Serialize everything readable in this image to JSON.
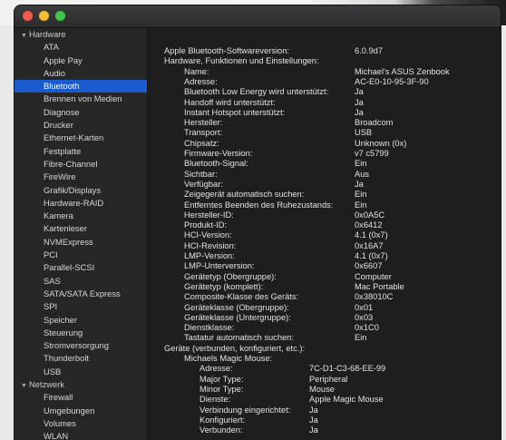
{
  "sidebar": {
    "items": [
      {
        "label": "Hardware",
        "group": true
      },
      {
        "label": "ATA"
      },
      {
        "label": "Apple Pay"
      },
      {
        "label": "Audio"
      },
      {
        "label": "Bluetooth",
        "selected": true
      },
      {
        "label": "Brennen von Medien"
      },
      {
        "label": "Diagnose"
      },
      {
        "label": "Drucker"
      },
      {
        "label": "Ethernet-Karten"
      },
      {
        "label": "Festplatte"
      },
      {
        "label": "Fibre-Channel"
      },
      {
        "label": "FireWire"
      },
      {
        "label": "Grafik/Displays"
      },
      {
        "label": "Hardware-RAID"
      },
      {
        "label": "Kamera"
      },
      {
        "label": "Kartenleser"
      },
      {
        "label": "NVMExpress"
      },
      {
        "label": "PCI"
      },
      {
        "label": "Parallel-SCSI"
      },
      {
        "label": "SAS"
      },
      {
        "label": "SATA/SATA Express"
      },
      {
        "label": "SPI"
      },
      {
        "label": "Speicher"
      },
      {
        "label": "Steuerung"
      },
      {
        "label": "Stromversorgung"
      },
      {
        "label": "Thunderbolt"
      },
      {
        "label": "USB"
      },
      {
        "label": "Netzwerk",
        "group": true
      },
      {
        "label": "Firewall"
      },
      {
        "label": "Umgebungen"
      },
      {
        "label": "Volumes"
      },
      {
        "label": "WLAN"
      }
    ]
  },
  "details": {
    "rows": [
      {
        "label": "Apple Bluetooth-Softwareversion:",
        "value": "6.0.9d7",
        "indent": 0
      },
      {
        "label": "Hardware, Funktionen und Einstellungen:",
        "value": "",
        "indent": 0
      },
      {
        "label": "Name:",
        "value": "Michael's ASUS Zenbook",
        "indent": 1
      },
      {
        "label": "Adresse:",
        "value": "AC-E0-10-95-3F-90",
        "indent": 1
      },
      {
        "label": "Bluetooth Low Energy wird unterstützt:",
        "value": "Ja",
        "indent": 1
      },
      {
        "label": "Handoff wird unterstützt:",
        "value": "Ja",
        "indent": 1
      },
      {
        "label": "Instant Hotspot unterstützt:",
        "value": "Ja",
        "indent": 1
      },
      {
        "label": "Hersteller:",
        "value": "Broadcom",
        "indent": 1
      },
      {
        "label": "Transport:",
        "value": "USB",
        "indent": 1
      },
      {
        "label": "Chipsatz:",
        "value": "Unknown (0x)",
        "indent": 1
      },
      {
        "label": "Firmware-Version:",
        "value": "v7 c5799",
        "indent": 1
      },
      {
        "label": "Bluetooth-Signal:",
        "value": "Ein",
        "indent": 1
      },
      {
        "label": "Sichtbar:",
        "value": "Aus",
        "indent": 1
      },
      {
        "label": "Verfügbar:",
        "value": "Ja",
        "indent": 1
      },
      {
        "label": "Zeigegerät automatisch suchen:",
        "value": "Ein",
        "indent": 1
      },
      {
        "label": "Entferntes Beenden des Ruhezustands:",
        "value": "Ein",
        "indent": 1
      },
      {
        "label": "Hersteller-ID:",
        "value": "0x0A5C",
        "indent": 1
      },
      {
        "label": "Produkt-ID:",
        "value": "0x6412",
        "indent": 1
      },
      {
        "label": "HCI-Version:",
        "value": "4.1 (0x7)",
        "indent": 1
      },
      {
        "label": "HCI-Revision:",
        "value": "0x16A7",
        "indent": 1
      },
      {
        "label": "LMP-Version:",
        "value": "4.1 (0x7)",
        "indent": 1
      },
      {
        "label": "LMP-Unterversion:",
        "value": "0x6607",
        "indent": 1
      },
      {
        "label": "Gerätetyp (Obergruppe):",
        "value": "Computer",
        "indent": 1
      },
      {
        "label": "Gerätetyp (komplett):",
        "value": "Mac Portable",
        "indent": 1
      },
      {
        "label": "Composite-Klasse des Geräts:",
        "value": "0x38010C",
        "indent": 1
      },
      {
        "label": "Geräteklasse (Obergruppe):",
        "value": "0x01",
        "indent": 1
      },
      {
        "label": "Geräteklasse (Untergruppe):",
        "value": "0x03",
        "indent": 1
      },
      {
        "label": "Dienstklasse:",
        "value": "0x1C0",
        "indent": 1
      },
      {
        "label": "Tastatur automatisch suchen:",
        "value": "Ein",
        "indent": 1
      },
      {
        "label": "Geräte (verbunden, konfiguriert, etc.):",
        "value": "",
        "indent": 0
      },
      {
        "label": "Michaels Magic Mouse:",
        "value": "",
        "indent": 1
      },
      {
        "label": "Adresse:",
        "value": "7C-D1-C3-68-EE-99",
        "indent": 2
      },
      {
        "label": "Major Type:",
        "value": "Peripheral",
        "indent": 2
      },
      {
        "label": "Minor Type:",
        "value": "Mouse",
        "indent": 2
      },
      {
        "label": "Dienste:",
        "value": "Apple Magic Mouse",
        "indent": 2
      },
      {
        "label": "Verbindung eingerichtet:",
        "value": "Ja",
        "indent": 2
      },
      {
        "label": "Konfiguriert:",
        "value": "Ja",
        "indent": 2
      },
      {
        "label": "Verbunden:",
        "value": "Ja",
        "indent": 2
      }
    ]
  }
}
